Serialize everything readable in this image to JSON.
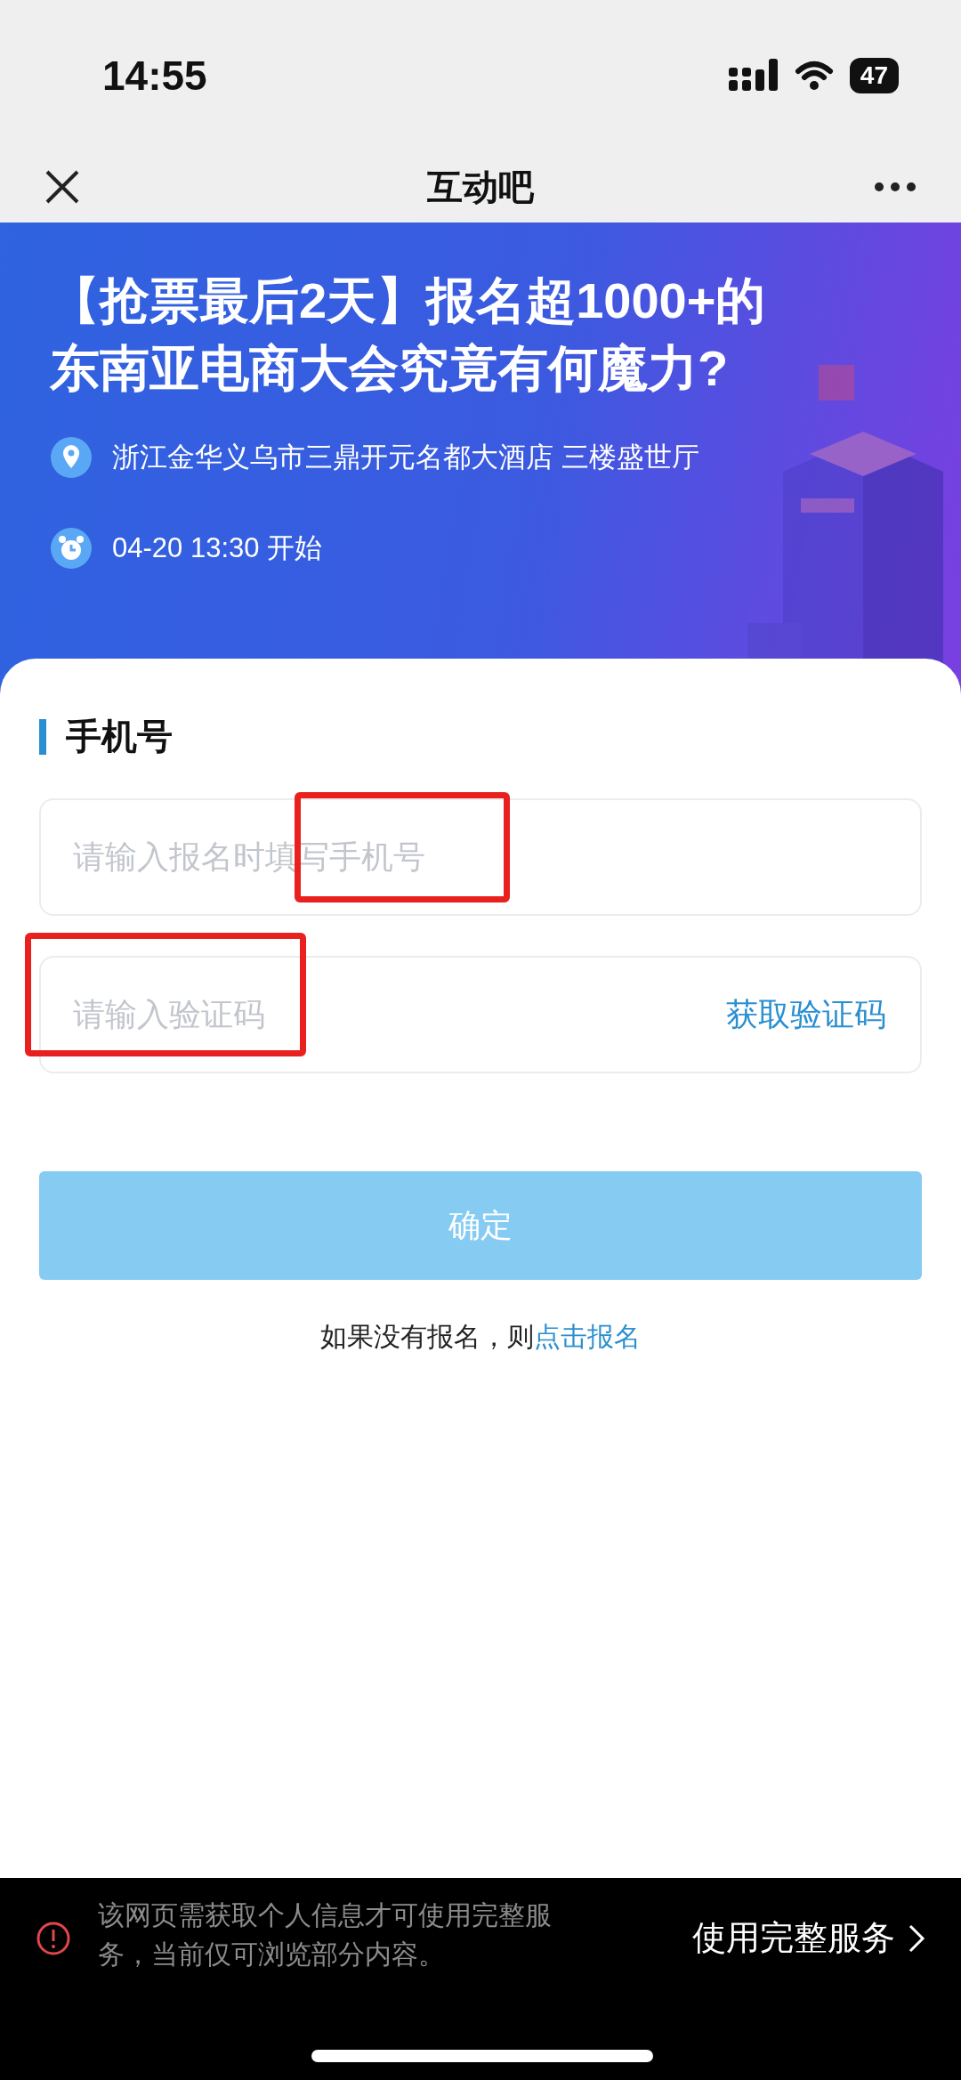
{
  "status_bar": {
    "time": "14:55",
    "battery": "47"
  },
  "nav": {
    "title": "互动吧"
  },
  "banner": {
    "title": "【抢票最后2天】报名超1000+的东南亚电商大会究竟有何魔力?",
    "location": "浙江金华义乌市三鼎开元名都大酒店 三楼盛世厅",
    "time": "04-20 13:30 开始"
  },
  "form": {
    "section_title": "手机号",
    "fields": [
      {
        "placeholder": "请输入报名时填写手机号",
        "highlighted": true
      },
      {
        "placeholder": "请输入验证码",
        "highlighted": true,
        "action": "获取验证码"
      }
    ],
    "submit": {
      "label": "确定",
      "disabled": true
    },
    "hint": "如果没有报名，则",
    "hint_link": "点击报名"
  },
  "notice": {
    "text": "该网页需获取个人信息才可使用完整服务，当前仅可浏览部分内容。",
    "action": "使用完整服务"
  }
}
